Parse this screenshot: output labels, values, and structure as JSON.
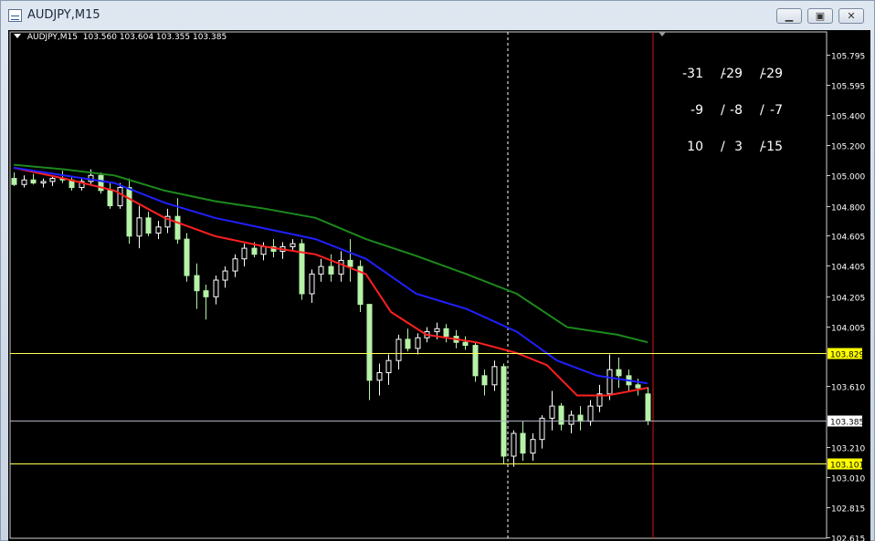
{
  "window": {
    "title": "AUDJPY,M15",
    "min_glyph": "▁",
    "max_glyph": "▣",
    "close_glyph": "✕"
  },
  "chart_info": {
    "symbol": "AUDJPY,M15",
    "ohlc": "103.560 103.604 103.355 103.385"
  },
  "signals": {
    "rows": [
      [
        "-31",
        "-29",
        "-29"
      ],
      [
        "-9",
        "-8",
        "-7"
      ],
      [
        "10",
        "3",
        "-15"
      ]
    ],
    "separator": "/"
  },
  "price_scale": [
    "105.795",
    "105.595",
    "105.400",
    "105.200",
    "105.000",
    "104.800",
    "104.605",
    "104.405",
    "104.205",
    "104.005",
    "103.610",
    "103.210",
    "103.010",
    "102.815",
    "102.615"
  ],
  "levels": [
    {
      "label": "103.829",
      "price": 103.829,
      "line_color": "#ffff55",
      "box_color": "#ffff00",
      "text_color": "#000000"
    },
    {
      "label": "103.385",
      "price": 103.385,
      "line_color": "#b0b0c0",
      "box_color": "#ffffff",
      "text_color": "#000000"
    },
    {
      "label": "103.101",
      "price": 103.101,
      "line_color": "#ffff55",
      "box_color": "#ffff00",
      "text_color": "#000000"
    }
  ],
  "chart_data": {
    "type": "candlestick",
    "symbol": "AUDJPY",
    "timeframe": "M15",
    "ylim": [
      102.615,
      105.9
    ],
    "colors": {
      "bull": "#ffffff",
      "bear": "#b6f2a8",
      "ma_fast": "#ff2020",
      "ma_mid": "#2020ff",
      "ma_slow": "#1c8a1c"
    },
    "moving_averages": [
      {
        "color": "ma_fast",
        "points": [
          [
            0,
            105.05
          ],
          [
            10,
            104.98
          ],
          [
            20,
            104.9
          ],
          [
            30,
            104.72
          ],
          [
            40,
            104.6
          ],
          [
            50,
            104.53
          ],
          [
            60,
            104.48
          ],
          [
            70,
            104.35
          ],
          [
            75,
            104.1
          ],
          [
            82,
            103.95
          ],
          [
            92,
            103.9
          ],
          [
            100,
            103.83
          ],
          [
            106,
            103.75
          ],
          [
            112,
            103.55
          ],
          [
            118,
            103.55
          ],
          [
            126,
            103.6
          ]
        ]
      },
      {
        "color": "ma_mid",
        "points": [
          [
            0,
            105.05
          ],
          [
            10,
            105.0
          ],
          [
            20,
            104.95
          ],
          [
            30,
            104.82
          ],
          [
            40,
            104.72
          ],
          [
            50,
            104.65
          ],
          [
            60,
            104.58
          ],
          [
            70,
            104.45
          ],
          [
            80,
            104.22
          ],
          [
            90,
            104.12
          ],
          [
            100,
            103.97
          ],
          [
            108,
            103.78
          ],
          [
            116,
            103.68
          ],
          [
            126,
            103.63
          ]
        ]
      },
      {
        "color": "ma_slow",
        "points": [
          [
            0,
            105.07
          ],
          [
            10,
            105.04
          ],
          [
            20,
            105.0
          ],
          [
            30,
            104.9
          ],
          [
            40,
            104.83
          ],
          [
            50,
            104.78
          ],
          [
            60,
            104.72
          ],
          [
            70,
            104.58
          ],
          [
            80,
            104.47
          ],
          [
            90,
            104.35
          ],
          [
            100,
            104.22
          ],
          [
            110,
            104.0
          ],
          [
            120,
            103.95
          ],
          [
            126,
            103.9
          ]
        ]
      }
    ],
    "candles": [
      [
        104.98,
        105.02,
        104.93,
        104.94
      ],
      [
        104.94,
        105.0,
        104.92,
        104.97
      ],
      [
        104.97,
        105.01,
        104.94,
        104.95
      ],
      [
        104.95,
        104.98,
        104.92,
        104.96
      ],
      [
        104.96,
        105.0,
        104.93,
        104.98
      ],
      [
        104.98,
        105.03,
        104.95,
        104.97
      ],
      [
        104.97,
        104.99,
        104.9,
        104.92
      ],
      [
        104.92,
        104.98,
        104.9,
        104.96
      ],
      [
        104.96,
        105.04,
        104.94,
        105.0
      ],
      [
        105.0,
        105.02,
        104.88,
        104.9
      ],
      [
        104.9,
        104.95,
        104.78,
        104.8
      ],
      [
        104.8,
        104.95,
        104.78,
        104.92
      ],
      [
        104.92,
        104.98,
        104.55,
        104.6
      ],
      [
        104.6,
        104.8,
        104.52,
        104.72
      ],
      [
        104.72,
        104.76,
        104.6,
        104.62
      ],
      [
        104.62,
        104.7,
        104.58,
        104.66
      ],
      [
        104.66,
        104.78,
        104.62,
        104.73
      ],
      [
        104.73,
        104.85,
        104.55,
        104.58
      ],
      [
        104.58,
        104.62,
        104.3,
        104.34
      ],
      [
        104.34,
        104.42,
        104.12,
        104.24
      ],
      [
        104.24,
        104.28,
        104.05,
        104.2
      ],
      [
        104.2,
        104.34,
        104.15,
        104.31
      ],
      [
        104.31,
        104.4,
        104.26,
        104.37
      ],
      [
        104.37,
        104.48,
        104.33,
        104.45
      ],
      [
        104.45,
        104.55,
        104.4,
        104.52
      ],
      [
        104.52,
        104.56,
        104.46,
        104.48
      ],
      [
        104.48,
        104.56,
        104.44,
        104.53
      ],
      [
        104.53,
        104.58,
        104.46,
        104.5
      ],
      [
        104.5,
        104.56,
        104.45,
        104.53
      ],
      [
        104.53,
        104.58,
        104.5,
        104.55
      ],
      [
        104.55,
        104.58,
        104.18,
        104.22
      ],
      [
        104.22,
        104.38,
        104.16,
        104.35
      ],
      [
        104.35,
        104.45,
        104.3,
        104.4
      ],
      [
        104.4,
        104.48,
        104.3,
        104.35
      ],
      [
        104.35,
        104.5,
        104.3,
        104.44
      ],
      [
        104.44,
        104.58,
        104.3,
        104.4
      ],
      [
        104.4,
        104.44,
        104.1,
        104.15
      ],
      [
        104.15,
        103.98,
        103.52,
        103.65
      ],
      [
        103.65,
        103.76,
        103.55,
        103.7
      ],
      [
        103.7,
        103.82,
        103.62,
        103.78
      ],
      [
        103.78,
        103.95,
        103.72,
        103.92
      ],
      [
        103.92,
        103.99,
        103.84,
        103.86
      ],
      [
        103.86,
        103.96,
        103.82,
        103.93
      ],
      [
        103.93,
        104.0,
        103.9,
        103.97
      ],
      [
        103.97,
        104.03,
        103.92,
        103.99
      ],
      [
        103.99,
        104.02,
        103.9,
        103.94
      ],
      [
        103.94,
        103.98,
        103.86,
        103.9
      ],
      [
        103.9,
        103.94,
        103.85,
        103.88
      ],
      [
        103.88,
        103.9,
        103.64,
        103.68
      ],
      [
        103.68,
        103.72,
        103.55,
        103.62
      ],
      [
        103.62,
        103.78,
        103.58,
        103.74
      ],
      [
        103.74,
        103.76,
        103.1,
        103.15
      ],
      [
        103.15,
        103.32,
        103.08,
        103.3
      ],
      [
        103.3,
        103.38,
        103.12,
        103.17
      ],
      [
        103.17,
        103.3,
        103.12,
        103.26
      ],
      [
        103.26,
        103.42,
        103.2,
        103.4
      ],
      [
        103.4,
        103.58,
        103.32,
        103.48
      ],
      [
        103.48,
        103.5,
        103.32,
        103.36
      ],
      [
        103.36,
        103.45,
        103.3,
        103.42
      ],
      [
        103.42,
        103.48,
        103.32,
        103.38
      ],
      [
        103.38,
        103.52,
        103.35,
        103.48
      ],
      [
        103.48,
        103.62,
        103.44,
        103.56
      ],
      [
        103.56,
        103.82,
        103.52,
        103.72
      ],
      [
        103.72,
        103.8,
        103.6,
        103.68
      ],
      [
        103.68,
        103.72,
        103.58,
        103.62
      ],
      [
        103.62,
        103.66,
        103.55,
        103.6
      ],
      [
        103.56,
        103.604,
        103.355,
        103.385
      ]
    ]
  }
}
